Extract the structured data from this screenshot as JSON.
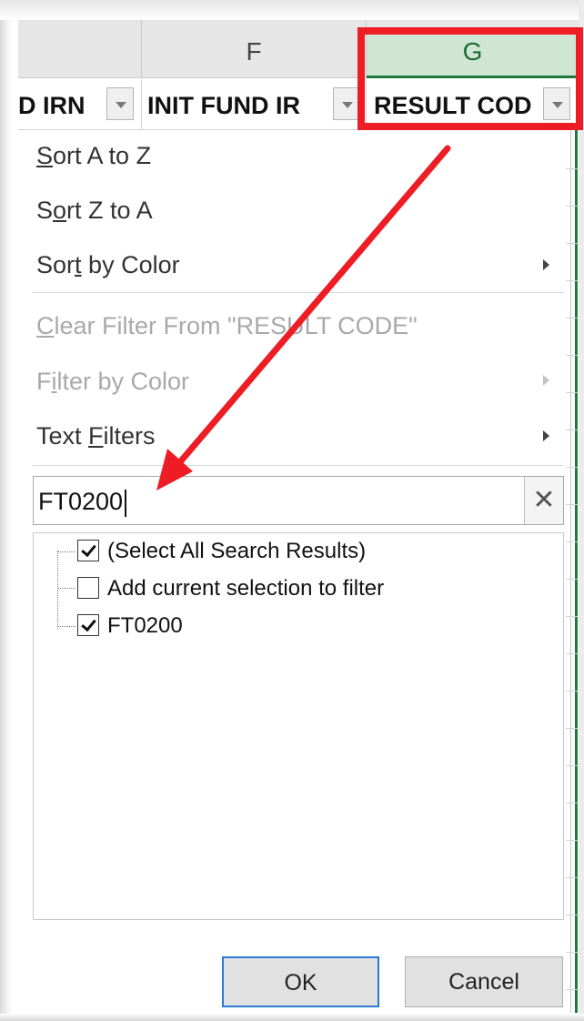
{
  "columns": {
    "f_letter": "F",
    "g_letter": "G"
  },
  "header_row": {
    "col_e_text": "D IRN",
    "col_f_text": "INIT FUND IR",
    "col_g_text": "RESULT COD"
  },
  "menu": {
    "sort_a_z": {
      "pre": "",
      "ul": "S",
      "post": "ort A to Z"
    },
    "sort_z_a": {
      "pre": "S",
      "ul": "o",
      "post": "rt Z to A"
    },
    "sort_color": {
      "pre": "Sor",
      "ul": "t",
      "post": " by Color"
    },
    "clear_filter": {
      "pre": "",
      "ul": "C",
      "post": "lear Filter From \"RESULT CODE\""
    },
    "filter_color": {
      "pre": "F",
      "ul": "i",
      "post": "lter by Color"
    },
    "text_filters": {
      "pre": "Text ",
      "ul": "F",
      "post": "ilters"
    }
  },
  "search": {
    "value": "FT0200",
    "clear_glyph": "✕"
  },
  "list": {
    "items": [
      {
        "label": "(Select All Search Results)",
        "checked": true
      },
      {
        "label": "Add current selection to filter",
        "checked": false
      },
      {
        "label": "FT0200",
        "checked": true
      }
    ]
  },
  "buttons": {
    "ok": "OK",
    "cancel": "Cancel"
  },
  "colors": {
    "highlight": "#ee1c24",
    "selected_column": "#cfe6d4",
    "selected_column_border": "#1d7a3a",
    "ok_focus": "#2b79d6"
  },
  "icons": {
    "dropdown": "chevron-down-icon",
    "submenu": "chevron-right-icon",
    "clear": "close-icon",
    "annotation": "red-arrow-annotation"
  }
}
